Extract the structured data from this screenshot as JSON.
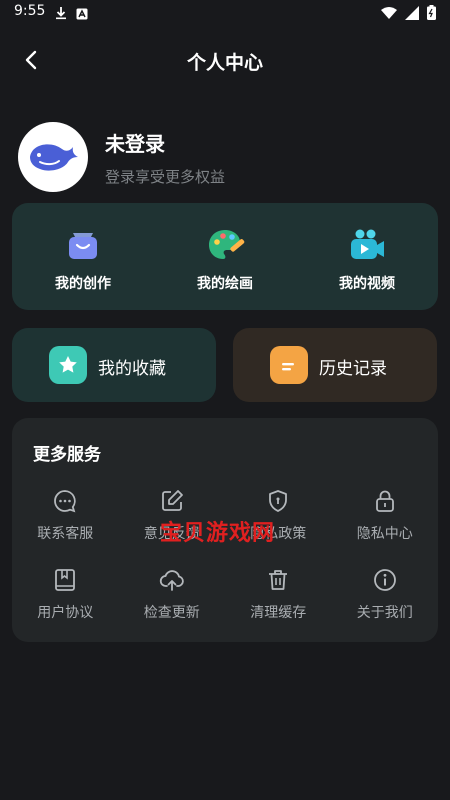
{
  "status_bar": {
    "time": "9:55"
  },
  "header": {
    "title": "个人中心"
  },
  "profile": {
    "name": "未登录",
    "subtitle": "登录享受更多权益"
  },
  "works": [
    {
      "label": "我的创作"
    },
    {
      "label": "我的绘画"
    },
    {
      "label": "我的视频"
    }
  ],
  "favorites": {
    "label": "我的收藏"
  },
  "history": {
    "label": "历史记录"
  },
  "services": {
    "title": "更多服务",
    "items": [
      {
        "label": "联系客服",
        "icon": "chat-icon"
      },
      {
        "label": "意见反馈",
        "icon": "edit-icon"
      },
      {
        "label": "隐私政策",
        "icon": "shield-icon"
      },
      {
        "label": "隐私中心",
        "icon": "lock-icon"
      },
      {
        "label": "用户协议",
        "icon": "book-icon"
      },
      {
        "label": "检查更新",
        "icon": "cloud-upload-icon"
      },
      {
        "label": "清理缓存",
        "icon": "trash-icon"
      },
      {
        "label": "关于我们",
        "icon": "info-icon"
      }
    ]
  },
  "watermark": "宝贝游戏网",
  "colors": {
    "background": "#18191c",
    "works_card": "#1f3333",
    "history_card": "#302923",
    "services_card": "#232628",
    "accent_teal": "#3ec9b5",
    "accent_orange": "#f4a444",
    "watermark_red": "#e02020"
  }
}
